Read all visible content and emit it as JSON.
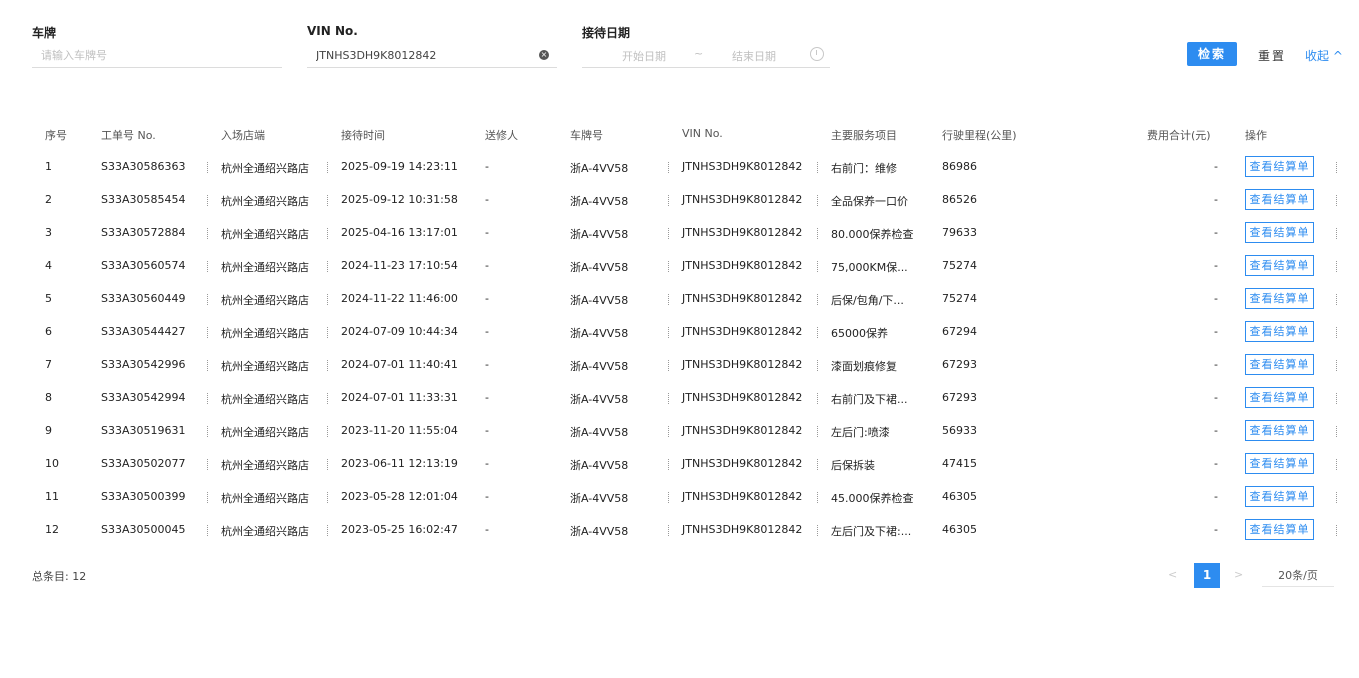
{
  "filters": {
    "plate_label": "车牌",
    "plate_placeholder": "请输入车牌号",
    "vin_label": "VIN No.",
    "vin_value": "JTNHS3DH9K8012842",
    "date_label": "接待日期",
    "start_placeholder": "开始日期",
    "date_separator": "~",
    "end_placeholder": "结束日期",
    "search_label": "检索",
    "reset_label": "重置",
    "collapse_label": "收起 ^"
  },
  "table": {
    "headers": {
      "seq": "序号",
      "order_no": "工单号 No.",
      "store": "入场店端",
      "time": "接待时间",
      "sender": "送修人",
      "plate": "车牌号",
      "vin": "VIN No.",
      "service": "主要服务项目",
      "mileage": "行驶里程(公里)",
      "fee": "费用合计(元)",
      "action": "操作"
    },
    "rows": [
      {
        "seq": "1",
        "order_no": "S33A30586363",
        "store": "杭州全通绍兴路店",
        "time": "2025-09-19 14:23:11",
        "sender": "-",
        "plate": "浙A-4VV58",
        "vin": "JTNHS3DH9K8012842",
        "service": "右前门：维修",
        "mileage": "86986",
        "fee": "-",
        "action": "查看结算单"
      },
      {
        "seq": "2",
        "order_no": "S33A30585454",
        "store": "杭州全通绍兴路店",
        "time": "2025-09-12 10:31:58",
        "sender": "-",
        "plate": "浙A-4VV58",
        "vin": "JTNHS3DH9K8012842",
        "service": "全品保养一口价",
        "mileage": "86526",
        "fee": "-",
        "action": "查看结算单"
      },
      {
        "seq": "3",
        "order_no": "S33A30572884",
        "store": "杭州全通绍兴路店",
        "time": "2025-04-16 13:17:01",
        "sender": "-",
        "plate": "浙A-4VV58",
        "vin": "JTNHS3DH9K8012842",
        "service": "80.000保养检查",
        "mileage": "79633",
        "fee": "-",
        "action": "查看结算单"
      },
      {
        "seq": "4",
        "order_no": "S33A30560574",
        "store": "杭州全通绍兴路店",
        "time": "2024-11-23 17:10:54",
        "sender": "-",
        "plate": "浙A-4VV58",
        "vin": "JTNHS3DH9K8012842",
        "service": "75,000KM保...",
        "mileage": "75274",
        "fee": "-",
        "action": "查看结算单"
      },
      {
        "seq": "5",
        "order_no": "S33A30560449",
        "store": "杭州全通绍兴路店",
        "time": "2024-11-22 11:46:00",
        "sender": "-",
        "plate": "浙A-4VV58",
        "vin": "JTNHS3DH9K8012842",
        "service": "后保/包角/下...",
        "mileage": "75274",
        "fee": "-",
        "action": "查看结算单"
      },
      {
        "seq": "6",
        "order_no": "S33A30544427",
        "store": "杭州全通绍兴路店",
        "time": "2024-07-09 10:44:34",
        "sender": "-",
        "plate": "浙A-4VV58",
        "vin": "JTNHS3DH9K8012842",
        "service": "65000保养",
        "mileage": "67294",
        "fee": "-",
        "action": "查看结算单"
      },
      {
        "seq": "7",
        "order_no": "S33A30542996",
        "store": "杭州全通绍兴路店",
        "time": "2024-07-01 11:40:41",
        "sender": "-",
        "plate": "浙A-4VV58",
        "vin": "JTNHS3DH9K8012842",
        "service": "漆面划痕修复",
        "mileage": "67293",
        "fee": "-",
        "action": "查看结算单"
      },
      {
        "seq": "8",
        "order_no": "S33A30542994",
        "store": "杭州全通绍兴路店",
        "time": "2024-07-01 11:33:31",
        "sender": "-",
        "plate": "浙A-4VV58",
        "vin": "JTNHS3DH9K8012842",
        "service": "右前门及下裙...",
        "mileage": "67293",
        "fee": "-",
        "action": "查看结算单"
      },
      {
        "seq": "9",
        "order_no": "S33A30519631",
        "store": "杭州全通绍兴路店",
        "time": "2023-11-20 11:55:04",
        "sender": "-",
        "plate": "浙A-4VV58",
        "vin": "JTNHS3DH9K8012842",
        "service": "左后门:喷漆",
        "mileage": "56933",
        "fee": "-",
        "action": "查看结算单"
      },
      {
        "seq": "10",
        "order_no": "S33A30502077",
        "store": "杭州全通绍兴路店",
        "time": "2023-06-11 12:13:19",
        "sender": "-",
        "plate": "浙A-4VV58",
        "vin": "JTNHS3DH9K8012842",
        "service": "后保拆装",
        "mileage": "47415",
        "fee": "-",
        "action": "查看结算单"
      },
      {
        "seq": "11",
        "order_no": "S33A30500399",
        "store": "杭州全通绍兴路店",
        "time": "2023-05-28 12:01:04",
        "sender": "-",
        "plate": "浙A-4VV58",
        "vin": "JTNHS3DH9K8012842",
        "service": "45.000保养检查",
        "mileage": "46305",
        "fee": "-",
        "action": "查看结算单"
      },
      {
        "seq": "12",
        "order_no": "S33A30500045",
        "store": "杭州全通绍兴路店",
        "time": "2023-05-25 16:02:47",
        "sender": "-",
        "plate": "浙A-4VV58",
        "vin": "JTNHS3DH9K8012842",
        "service": "左后门及下裙:...",
        "mileage": "46305",
        "fee": "-",
        "action": "查看结算单"
      }
    ]
  },
  "footer": {
    "total_label": "总条目: 12",
    "current_page": "1",
    "prev_symbol": "<",
    "next_symbol": ">",
    "page_size": "20条/页"
  },
  "colors": {
    "accent": "#2d8cf0",
    "header_text": "#555555",
    "body_text": "#222222"
  }
}
